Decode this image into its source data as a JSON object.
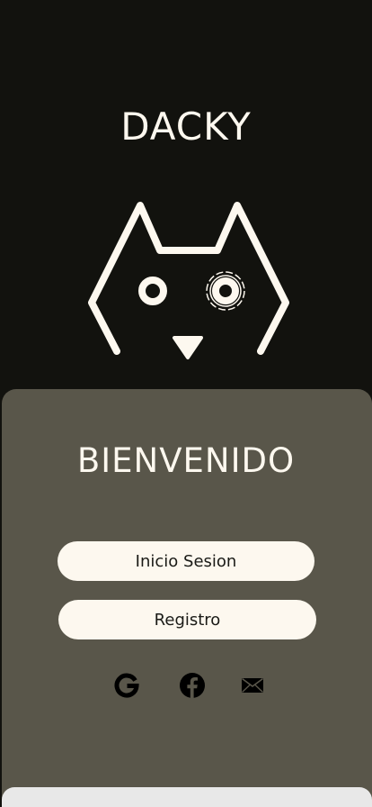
{
  "app": {
    "title": "DACKY",
    "logo_icon": "cat-robot-logo-icon"
  },
  "welcome": {
    "heading": "BIENVENIDO"
  },
  "actions": {
    "login_label": "Inicio Sesion",
    "register_label": "Registro"
  },
  "social": [
    {
      "icon": "google-icon"
    },
    {
      "icon": "facebook-icon"
    },
    {
      "icon": "email-icon"
    }
  ],
  "colors": {
    "background": "#12120e",
    "panel": "#59564a",
    "button": "#fdf8ef",
    "text_light": "#fdf8ef",
    "text_dark": "#1a1a16"
  }
}
